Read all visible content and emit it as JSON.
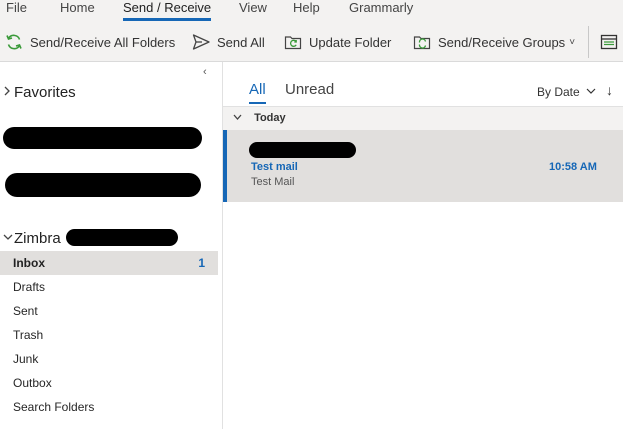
{
  "ribbon": {
    "tabs": [
      {
        "label": "File"
      },
      {
        "label": "Home"
      },
      {
        "label": "Send / Receive"
      },
      {
        "label": "View"
      },
      {
        "label": "Help"
      },
      {
        "label": "Grammarly"
      }
    ],
    "active_tab": "Send / Receive",
    "commands": [
      {
        "label": "Send/Receive All Folders",
        "icon": "sync-icon"
      },
      {
        "label": "Send All",
        "icon": "send-icon"
      },
      {
        "label": "Update Folder",
        "icon": "update-folder-icon"
      },
      {
        "label": "Send/Receive Groups",
        "icon": "sync-groups-icon"
      }
    ],
    "groups_dropdown_glyph": "˅",
    "overflow_icon": "layout-icon",
    "accent_color": "#1667b6",
    "sync_icon_color": "#3a9a3a"
  },
  "folder_pane": {
    "collapse_glyph": "‹",
    "favorites_label": "Favorites",
    "account_label": "Zimbra",
    "folders": [
      {
        "label": "Inbox",
        "count": "1",
        "selected": true
      },
      {
        "label": "Drafts",
        "count": ""
      },
      {
        "label": "Sent",
        "count": ""
      },
      {
        "label": "Trash",
        "count": ""
      },
      {
        "label": "Junk",
        "count": ""
      },
      {
        "label": "Outbox",
        "count": ""
      },
      {
        "label": "Search Folders",
        "count": ""
      }
    ]
  },
  "message_list": {
    "filter_tabs": [
      {
        "label": "All",
        "active": true
      },
      {
        "label": "Unread",
        "active": false
      }
    ],
    "sort_label": "By Date",
    "sort_chevron": "⌄",
    "sort_direction_glyph": "↓",
    "group_label": "Today",
    "messages": [
      {
        "subject": "Test mail",
        "preview": "Test Mail",
        "time": "10:58 AM",
        "selected": true
      }
    ]
  }
}
